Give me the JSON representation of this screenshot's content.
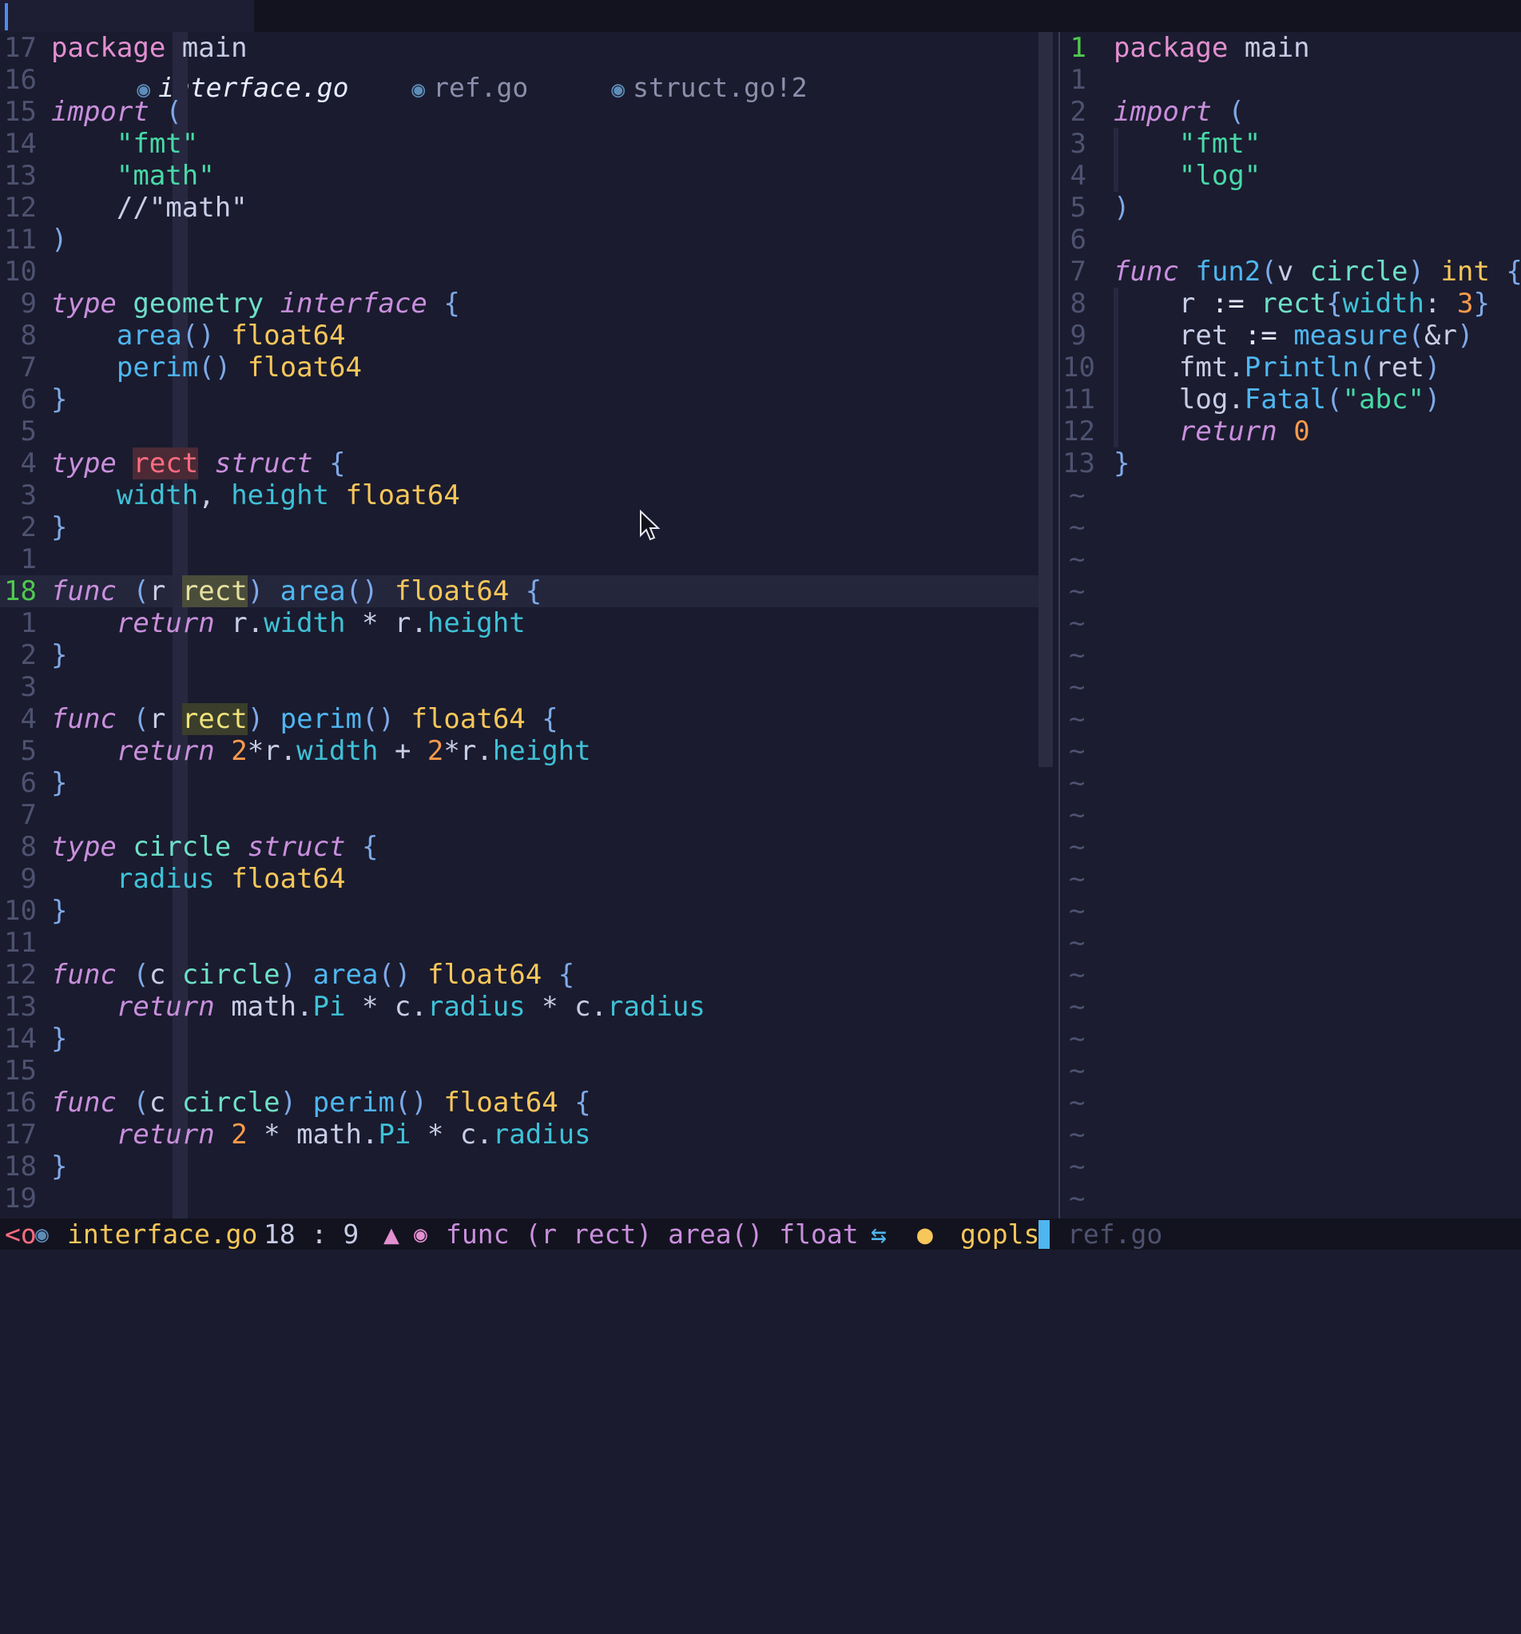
{
  "tabs": [
    {
      "label": "interface.go",
      "active": true
    },
    {
      "label": "ref.go",
      "active": false
    },
    {
      "label": "struct.go",
      "active": false,
      "badge": "!2"
    }
  ],
  "left_line_numbers": [
    "17",
    "16",
    "15",
    "14",
    "13",
    "12",
    "11",
    "10",
    "9",
    "8",
    "7",
    "6",
    "5",
    "4",
    "3",
    "2",
    "1",
    "18",
    "1",
    "2",
    "3",
    "4",
    "5",
    "6",
    "7",
    "8",
    "9",
    "10",
    "11",
    "12",
    "13",
    "14",
    "15",
    "16",
    "17",
    "18",
    "19"
  ],
  "left_code": [
    "package main",
    "",
    "import (",
    "    \"fmt\"",
    "    \"math\"",
    "    //\"math\"",
    ")",
    "",
    "type geometry interface {",
    "    area() float64",
    "    perim() float64",
    "}",
    "",
    "type rect struct {",
    "    width, height float64",
    "}",
    "",
    "func (r rect) area() float64 {",
    "    return r.width * r.height",
    "}",
    "",
    "func (r rect) perim() float64 {",
    "    return 2*r.width + 2*r.height",
    "}",
    "",
    "type circle struct {",
    "    radius float64",
    "}",
    "",
    "func (c circle) area() float64 {",
    "    return math.Pi * c.radius * c.radius",
    "}",
    "",
    "func (c circle) perim() float64 {",
    "    return 2 * math.Pi * c.radius",
    "}",
    ""
  ],
  "right_line_numbers": [
    "1",
    "1",
    "2",
    "3",
    "4",
    "5",
    "6",
    "7",
    "8",
    "9",
    "10",
    "11",
    "12",
    "13"
  ],
  "right_code": [
    "package main",
    "",
    "import (",
    "    \"fmt\"",
    "    \"log\"",
    ")",
    "",
    "func fun2(v circle) int {",
    "    r := rect{width: 3}",
    "    ret := measure(&r)",
    "    fmt.Println(ret)",
    "    log.Fatal(\"abc\")",
    "    return 0",
    "}"
  ],
  "tilde": "~",
  "status": {
    "mode": "<o",
    "filename": "interface.go",
    "position": "18 : 9",
    "context": "func (r rect) area() float",
    "lsp": "gopls",
    "other_file": "ref.go"
  },
  "colors": {
    "background": "#1a1b2e",
    "keyword": "#c98fdd",
    "type": "#6ee0c7",
    "function": "#4fb6ef",
    "builtin_type": "#f8c75a",
    "string": "#48d9a7",
    "number": "#fa9a4c",
    "current_line_number": "#4ec94e"
  },
  "icons": [
    "gopher-icon",
    "tree-icon",
    "owl-icon",
    "git-branch-icon",
    "leopard-icon",
    "mouse-pointer-icon"
  ]
}
